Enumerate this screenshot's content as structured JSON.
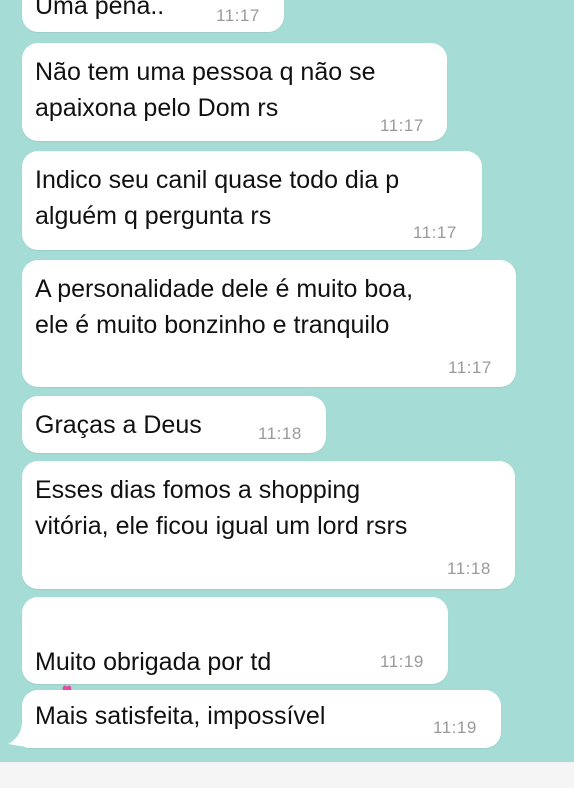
{
  "messages": [
    {
      "text": "Uma pena..",
      "time": "11:17"
    },
    {
      "text": "Não tem uma pessoa q não se\napaixona pelo Dom rs",
      "time": "11:17"
    },
    {
      "text": "Indico seu canil quase todo dia p\nalguém q pergunta rs",
      "time": "11:17"
    },
    {
      "text": "A personalidade dele é muito boa,\nele é muito bonzinho e tranquilo",
      "time": "11:17"
    },
    {
      "text": "Graças a Deus",
      "time": "11:18"
    },
    {
      "text": "Esses dias fomos a shopping\nvitória, ele ficou igual um lord rsrs",
      "time": "11:18"
    },
    {
      "text": "Muito obrigada por td",
      "time": "11:19",
      "emoji": [
        "revolving-hearts-icon",
        "revolving-hearts-icon"
      ]
    },
    {
      "text": "Mais satisfeita, impossível",
      "time": "11:19"
    }
  ],
  "colors": {
    "chat_background": "#a6dcd6",
    "bubble": "#ffffff",
    "time": "#9a9a9a",
    "heart": "#e9479a"
  }
}
